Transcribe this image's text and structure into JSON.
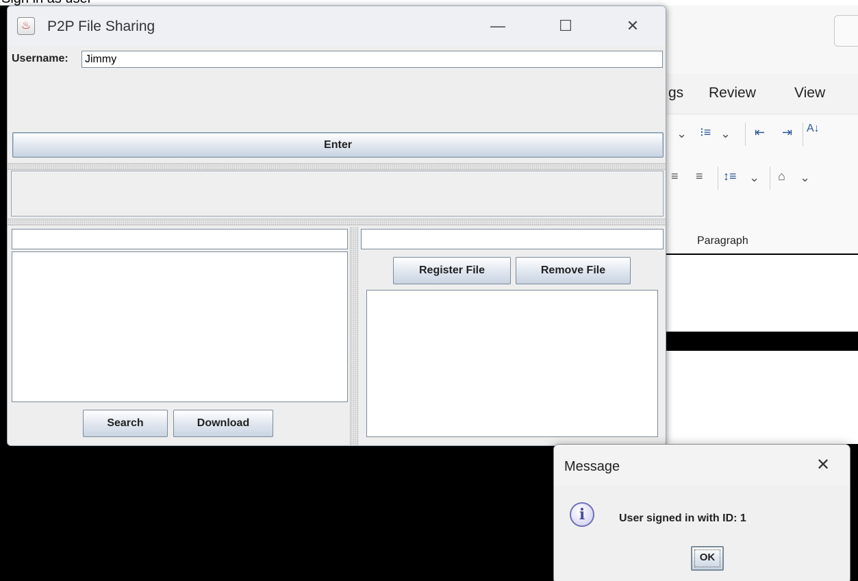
{
  "caption": {
    "text": "Sign in as user"
  },
  "word": {
    "tabs": [
      "gs",
      "Review",
      "View"
    ],
    "group_label": "Paragraph"
  },
  "app": {
    "title": "P2P File Sharing",
    "username_label": "Username:",
    "username_value": "Jimmy",
    "enter_label": "Enter",
    "search_label": "Search",
    "download_label": "Download",
    "register_label": "Register File",
    "remove_label": "Remove File"
  },
  "dialog": {
    "title": "Message",
    "message": "User signed in with ID: 1",
    "ok_label": "OK"
  },
  "icons": {
    "app": "java-cup-icon",
    "minimize": "minimize-icon",
    "maximize": "maximize-icon",
    "close": "close-icon",
    "info": "info-icon"
  }
}
